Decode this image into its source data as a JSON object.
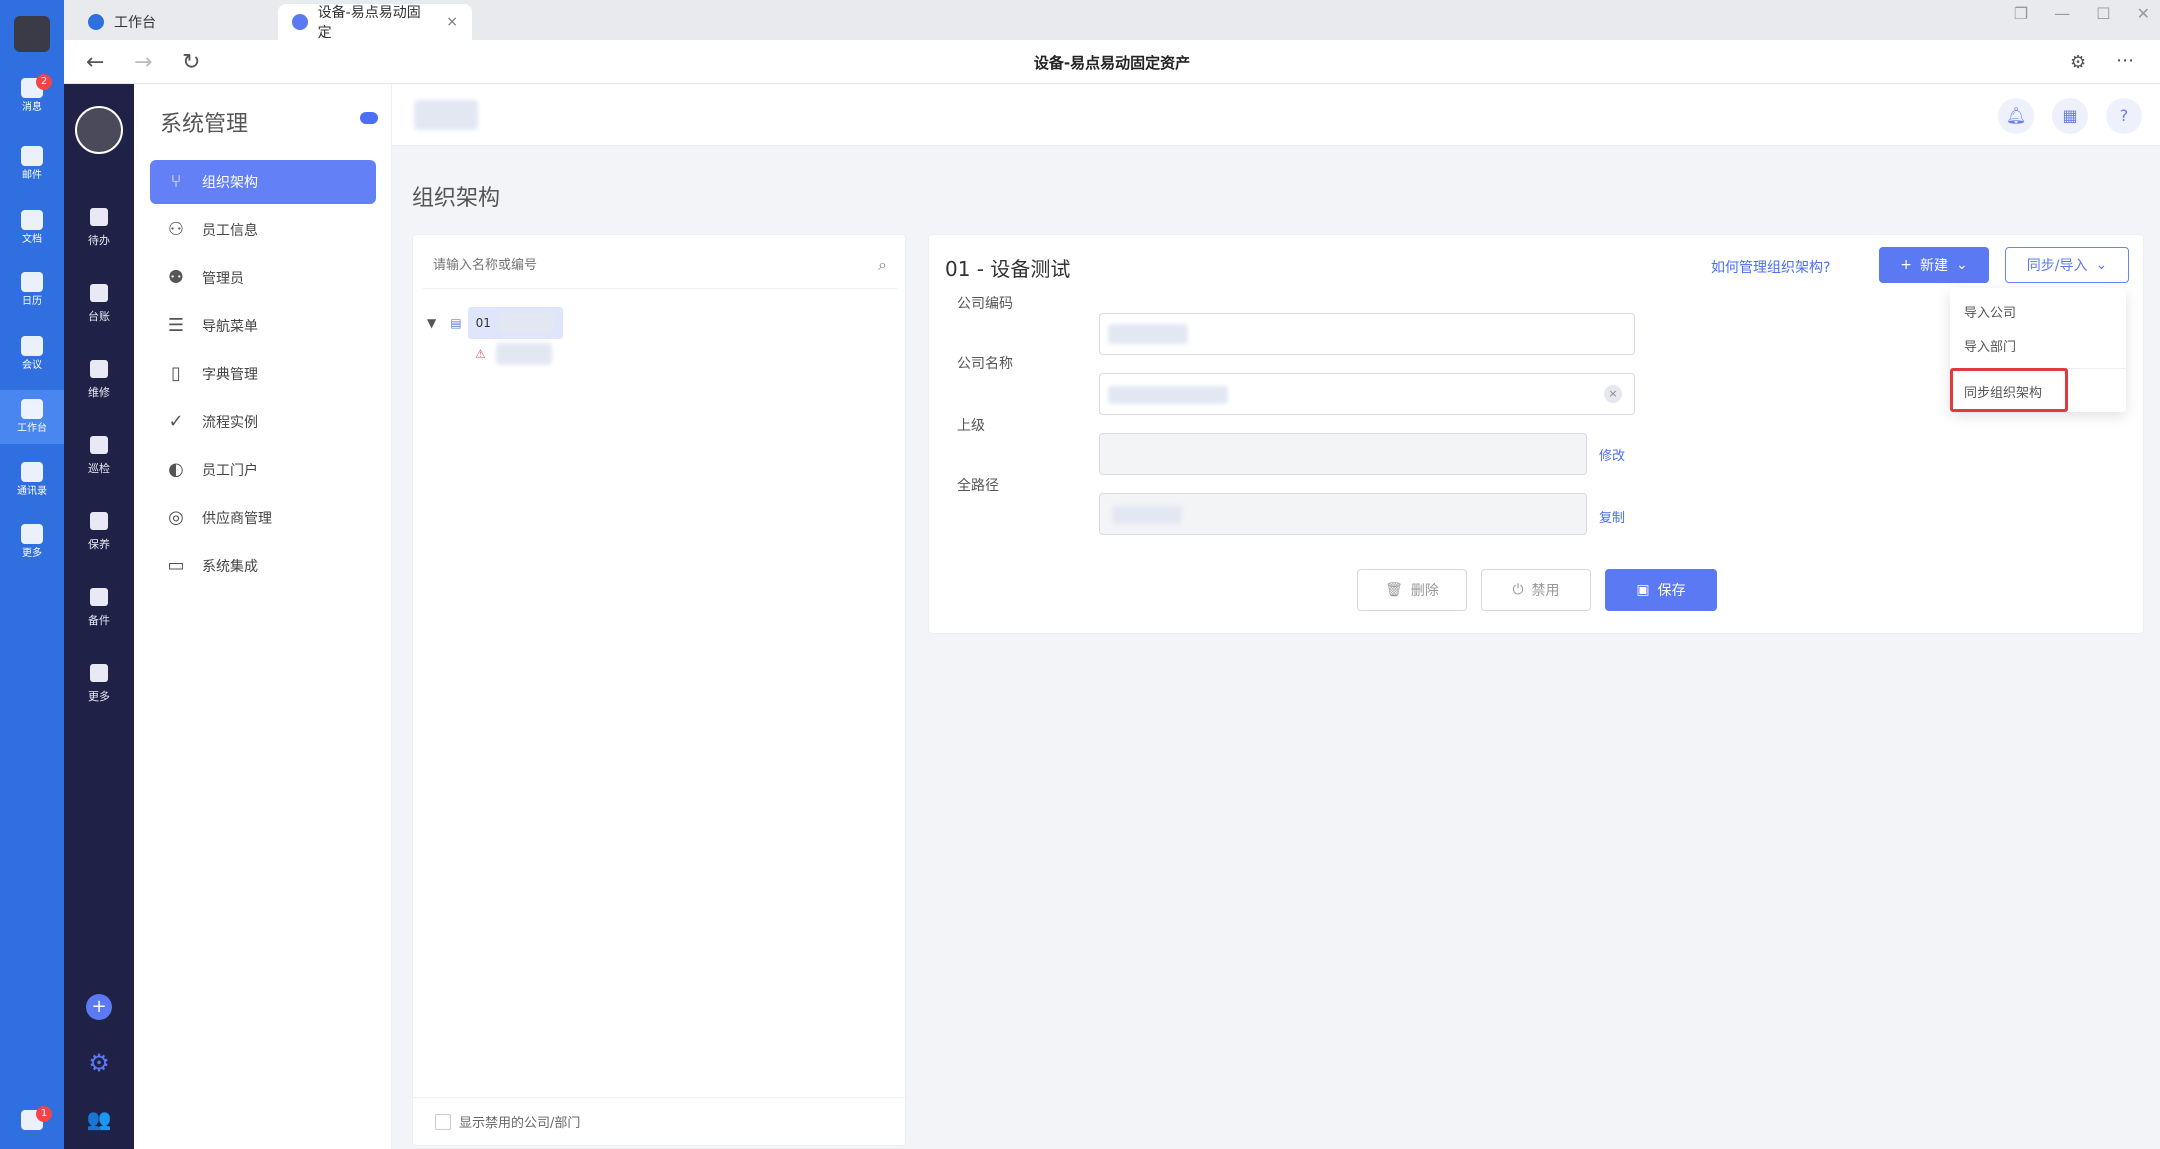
{
  "rail": {
    "items": [
      {
        "label": "消息",
        "badge": "2"
      },
      {
        "label": "邮件"
      },
      {
        "label": "文档"
      },
      {
        "label": "日历"
      },
      {
        "label": "会议"
      },
      {
        "label": "工作台"
      },
      {
        "label": "通讯录"
      },
      {
        "label": "更多"
      }
    ],
    "bottom_badge": "1"
  },
  "browser": {
    "tabs": [
      {
        "label": "工作台"
      },
      {
        "label": "设备-易点易动固定"
      }
    ],
    "title": "设备-易点易动固定资产"
  },
  "darkbar": {
    "items": [
      {
        "label": "待办"
      },
      {
        "label": "台账"
      },
      {
        "label": "维修"
      },
      {
        "label": "巡检"
      },
      {
        "label": "保养"
      },
      {
        "label": "备件"
      },
      {
        "label": "更多"
      }
    ]
  },
  "sysnav": {
    "title": "系统管理",
    "items": [
      {
        "label": "组织架构",
        "icon": "org-icon"
      },
      {
        "label": "员工信息",
        "icon": "user-add-icon"
      },
      {
        "label": "管理员",
        "icon": "users-icon"
      },
      {
        "label": "导航菜单",
        "icon": "list-icon"
      },
      {
        "label": "字典管理",
        "icon": "book-icon"
      },
      {
        "label": "流程实例",
        "icon": "check-circle-icon"
      },
      {
        "label": "员工门户",
        "icon": "toggle-icon"
      },
      {
        "label": "供应商管理",
        "icon": "globe-icon"
      },
      {
        "label": "系统集成",
        "icon": "monitor-icon"
      }
    ]
  },
  "page": {
    "title": "组织架构"
  },
  "tree": {
    "search_placeholder": "请输入名称或编号",
    "root_code": "01",
    "footer_label": "显示禁用的公司/部门"
  },
  "detail": {
    "title": "01 - 设备测试",
    "help_link": "如何管理组织架构?",
    "new_button": "新建",
    "sync_button": "同步/导入",
    "fields": [
      {
        "label": "公司编码"
      },
      {
        "label": "公司名称"
      },
      {
        "label": "上级",
        "link": "修改"
      },
      {
        "label": "全路径",
        "link": "复制"
      }
    ],
    "buttons": {
      "delete": "删除",
      "disable": "禁用",
      "save": "保存"
    }
  },
  "dropdown": {
    "items": [
      "导入公司",
      "导入部门",
      "同步组织架构"
    ]
  },
  "colors": {
    "rail": "#2f6fe0",
    "dark_sidebar": "#1f2246",
    "accent": "#5b79f3",
    "highlight": "#e23a3a"
  }
}
